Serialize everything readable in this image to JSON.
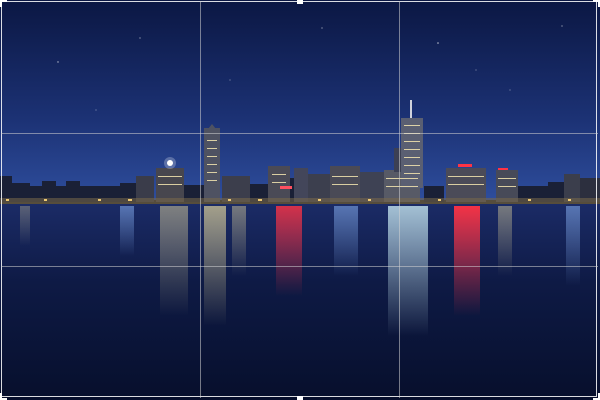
{
  "photo": {
    "subject": "city-skyline-night",
    "colors": {
      "sky_top": "#0d1a4a",
      "sky_horizon": "#2a4a9a",
      "water": "#0a1535",
      "reflection_red": "#e0202a",
      "reflection_warm": "#e8d890",
      "reflection_cyan": "#bfe8f0"
    }
  },
  "crop_overlay": {
    "grid": "rule-of-thirds",
    "line_color": "#d2d2d2",
    "handle_color": "#ffffff"
  }
}
